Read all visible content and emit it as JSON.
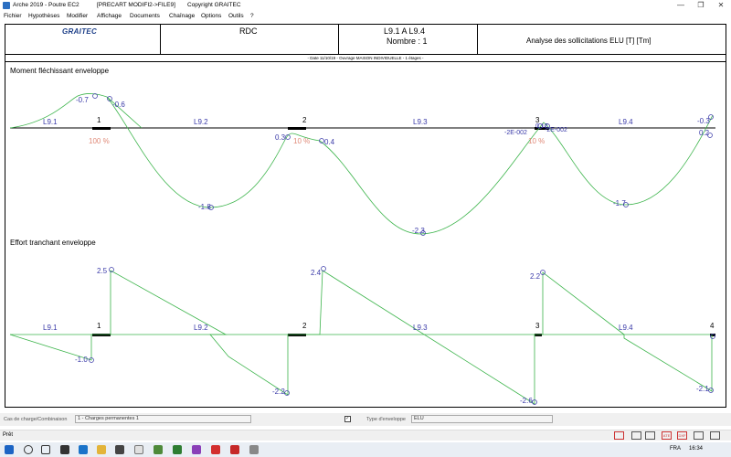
{
  "titlebar": {
    "app": "Arche 2019 - Poutre EC2",
    "file": "[PRECART MODIFI2->FILE9]",
    "copyright": "Copyright GRAITEC",
    "controls": [
      "—",
      "❐",
      "✕"
    ]
  },
  "menu": [
    "Fichier",
    "Hypothèses",
    "Modifier",
    "Affichage",
    "Documents",
    "Chaînage",
    "Options",
    "Outils",
    "?"
  ],
  "header": {
    "logo": "GRAITEC",
    "level": "RDC",
    "beams": "L9.1 A L9.4",
    "count": "Nombre : 1",
    "analysis": "Analyse des sollicitations ELU [T] [Tm]",
    "date_line": "- Date 11/10/19 - Ouvrage MAISON INDIVIDUELLE - 1 étages -"
  },
  "moment_title": "Moment fléchissant enveloppe",
  "shear_title": "Effort tranchant enveloppe",
  "colors": {
    "curve": "#3cb44b",
    "label": "#3a3aa8",
    "pct": "#e08a78",
    "axis": "#000000"
  },
  "chart_data": [
    {
      "type": "line",
      "title": "Moment fléchissant enveloppe",
      "units": "Tm",
      "supports": [
        "1",
        "2",
        "3"
      ],
      "spans": [
        "L9.1",
        "L9.2",
        "L9.3",
        "L9.4"
      ],
      "support_labels": [
        "100 %",
        "10 %",
        "10 %"
      ],
      "value_labels": [
        "-0.7",
        "-0.6",
        "0.3",
        "0.4",
        "-1.8",
        "-2.3",
        "0.12",
        "-2E-002",
        "-2E-002",
        "-1.7",
        "-0.3",
        "0.2"
      ]
    },
    {
      "type": "line",
      "title": "Effort tranchant enveloppe",
      "units": "T",
      "supports": [
        "1",
        "2",
        "3",
        "4"
      ],
      "spans": [
        "L9.1",
        "L9.2",
        "L9.3",
        "L9.4"
      ],
      "value_labels": [
        "2.5",
        "-1.0",
        "2.4",
        "-2.2",
        "2.2",
        "-2.6",
        "-2.1"
      ]
    }
  ],
  "status": {
    "case_label": "Cas de charge/Combinaison",
    "case_value": "1 - Charges permanentes 1",
    "env_label": "Type d'enveloppe",
    "env_value": "ELU",
    "checkbox": "✓",
    "ready": "Prêt",
    "icons": [
      "ATE",
      "DXF"
    ]
  },
  "tray": {
    "lang": "FRA",
    "time": "16:34"
  }
}
